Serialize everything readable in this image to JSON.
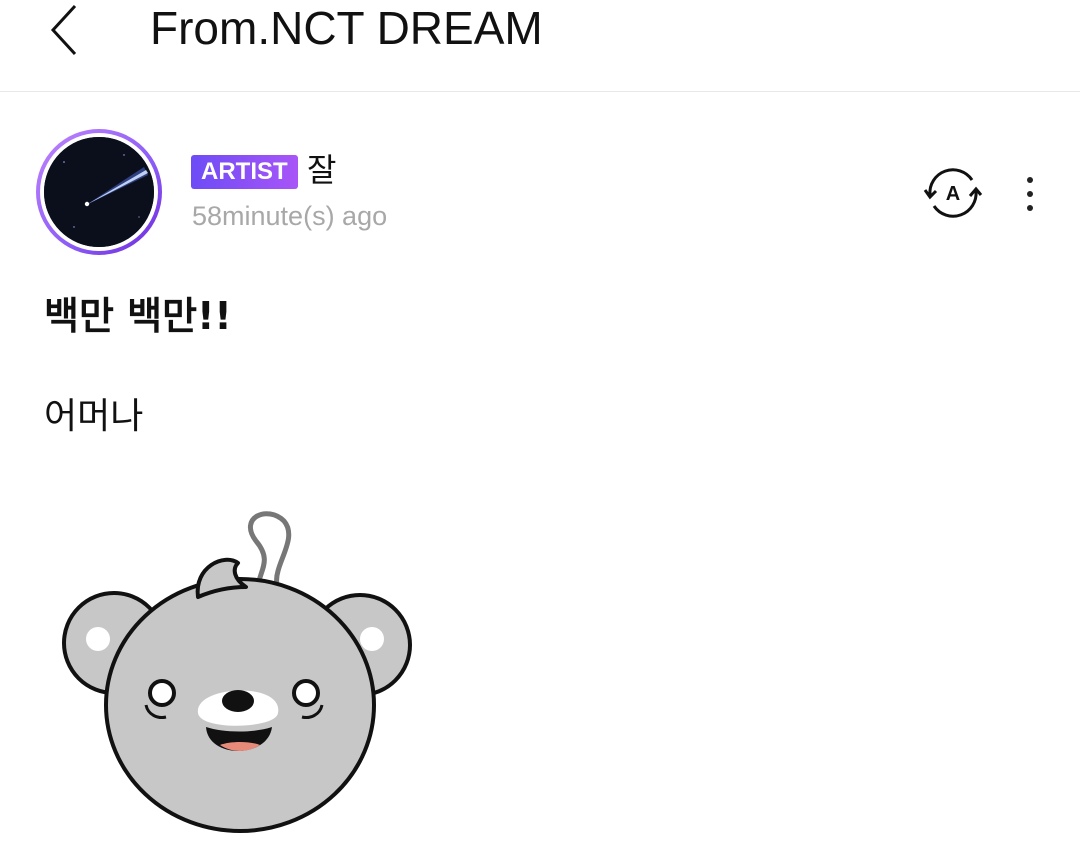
{
  "header": {
    "title": "From.NCT DREAM"
  },
  "post": {
    "badge": "ARTIST",
    "author": "잘",
    "time": "58minute(s) ago",
    "title": "백만 백만!!",
    "body": "어머나"
  },
  "colors": {
    "badge_start": "#6d4cf6",
    "badge_end": "#a855f7",
    "time_text": "#a8a8a8",
    "divider": "#e8e8e8"
  },
  "icons": {
    "back": "chevron-left-icon",
    "translate": "translate-icon",
    "more": "more-vertical-icon",
    "sticker": "bear-sticker"
  }
}
